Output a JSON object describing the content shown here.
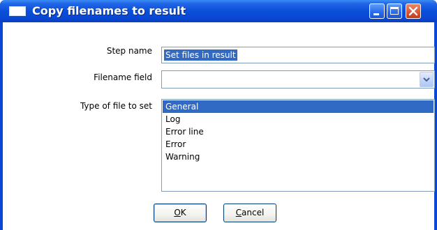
{
  "window": {
    "title": "Copy filenames to result"
  },
  "form": {
    "step_name": {
      "label": "Step name",
      "value": "Set files in result"
    },
    "filename_field": {
      "label": "Filename field",
      "value": ""
    },
    "file_type": {
      "label": "Type of file to set",
      "options": [
        "General",
        "Log",
        "Error line",
        "Error",
        "Warning"
      ],
      "selected": "General"
    }
  },
  "buttons": {
    "ok_label": "OK",
    "ok_mnemonic": "O",
    "ok_rest": "K",
    "cancel_label": "Cancel",
    "cancel_mnemonic": "C",
    "cancel_rest": "ancel"
  },
  "colors": {
    "titlebar": "#0a4fd8",
    "selection": "#316ac5",
    "close_button": "#d85434"
  },
  "icons": {
    "window_icon": "window-icon",
    "minimize": "minimize-icon",
    "maximize": "maximize-icon",
    "close": "close-icon",
    "dropdown": "chevron-down-icon"
  }
}
